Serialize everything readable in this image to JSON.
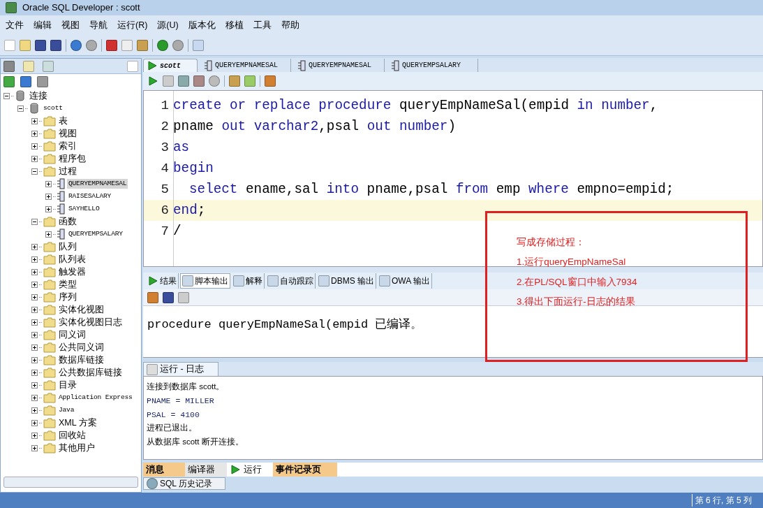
{
  "window": {
    "title": "Oracle SQL Developer : scott"
  },
  "menu": [
    "文件",
    "编辑",
    "视图",
    "导航",
    "运行(R)",
    "源(U)",
    "版本化",
    "移植",
    "工具",
    "帮助"
  ],
  "navigator": {
    "tree": [
      {
        "label": "连接",
        "expanded": true,
        "children": [
          {
            "label": "scott",
            "expanded": true,
            "children": [
              {
                "label": "表",
                "expanded": false,
                "selected": false
              },
              {
                "label": "视图",
                "expanded": false,
                "selected": false
              },
              {
                "label": "索引",
                "expanded": false,
                "selected": false
              },
              {
                "label": "程序包",
                "expanded": false,
                "selected": false
              },
              {
                "label": "过程",
                "expanded": true,
                "selected": false,
                "children": [
                  {
                    "label": "QUERYEMPNAMESAL",
                    "expanded": false,
                    "selected": true
                  },
                  {
                    "label": "RAISESALARY",
                    "expanded": false,
                    "selected": false
                  },
                  {
                    "label": "SAYHELLO",
                    "expanded": false,
                    "selected": false
                  }
                ]
              },
              {
                "label": "函数",
                "expanded": true,
                "selected": false,
                "children": [
                  {
                    "label": "QUERYEMPSALARY",
                    "expanded": false,
                    "selected": false
                  }
                ]
              },
              {
                "label": "队列",
                "expanded": false,
                "selected": false
              },
              {
                "label": "队列表",
                "expanded": false,
                "selected": false
              },
              {
                "label": "触发器",
                "expanded": false,
                "selected": false
              },
              {
                "label": "类型",
                "expanded": false,
                "selected": false
              },
              {
                "label": "序列",
                "expanded": false,
                "selected": false
              },
              {
                "label": "实体化视图",
                "expanded": false,
                "selected": false
              },
              {
                "label": "实体化视图日志",
                "expanded": false,
                "selected": false
              },
              {
                "label": "同义词",
                "expanded": false,
                "selected": false
              },
              {
                "label": "公共同义词",
                "expanded": false,
                "selected": false
              },
              {
                "label": "数据库链接",
                "expanded": false,
                "selected": false
              },
              {
                "label": "公共数据库链接",
                "expanded": false,
                "selected": false
              },
              {
                "label": "目录",
                "expanded": false,
                "selected": false
              },
              {
                "label": "Application Express",
                "expanded": false,
                "selected": false
              },
              {
                "label": "Java",
                "expanded": false,
                "selected": false
              },
              {
                "label": "XML 方案",
                "expanded": false,
                "selected": false
              },
              {
                "label": "回收站",
                "expanded": false,
                "selected": false
              },
              {
                "label": "其他用户",
                "expanded": false,
                "selected": false
              }
            ]
          }
        ]
      }
    ]
  },
  "editor_tabs": [
    {
      "label": "scott",
      "selected": true
    },
    {
      "label": "QUERYEMPNAMESAL",
      "selected": false
    },
    {
      "label": "QUERYEMPNAMESAL",
      "selected": false
    },
    {
      "label": "QUERYEMPSALARY",
      "selected": false
    }
  ],
  "code": [
    {
      "number": "1",
      "current": false,
      "tokens": [
        {
          "kind": "keyword",
          "text": "create or replace procedure "
        },
        {
          "kind": "plain",
          "text": "queryEmpNameSal(empid "
        },
        {
          "kind": "keyword",
          "text": "in number"
        },
        {
          "kind": "plain",
          "text": ","
        }
      ]
    },
    {
      "number": "2",
      "current": false,
      "tokens": [
        {
          "kind": "plain",
          "text": "pname "
        },
        {
          "kind": "keyword",
          "text": "out varchar2"
        },
        {
          "kind": "plain",
          "text": ",psal "
        },
        {
          "kind": "keyword",
          "text": "out number"
        },
        {
          "kind": "plain",
          "text": ")"
        }
      ]
    },
    {
      "number": "3",
      "current": false,
      "tokens": [
        {
          "kind": "keyword",
          "text": "as"
        }
      ]
    },
    {
      "number": "4",
      "current": false,
      "tokens": [
        {
          "kind": "keyword",
          "text": "begin"
        }
      ]
    },
    {
      "number": "5",
      "current": false,
      "indented": true,
      "tokens": [
        {
          "kind": "keyword",
          "text": "select"
        },
        {
          "kind": "plain",
          "text": " ename,sal "
        },
        {
          "kind": "keyword",
          "text": "into"
        },
        {
          "kind": "plain",
          "text": " pname,psal "
        },
        {
          "kind": "keyword",
          "text": "from"
        },
        {
          "kind": "plain",
          "text": " emp "
        },
        {
          "kind": "keyword",
          "text": "where"
        },
        {
          "kind": "plain",
          "text": " empno=empid;"
        }
      ]
    },
    {
      "number": "6",
      "current": true,
      "tokens": [
        {
          "kind": "keyword",
          "text": "end"
        },
        {
          "kind": "plain",
          "text": ";"
        }
      ]
    },
    {
      "number": "7",
      "current": false,
      "tokens": [
        {
          "kind": "plain",
          "text": "/"
        }
      ]
    }
  ],
  "output_tabs": [
    {
      "label": "结果",
      "selected": false
    },
    {
      "label": "脚本输出",
      "selected": true
    },
    {
      "label": "解释",
      "selected": false
    },
    {
      "label": "自动跟踪",
      "selected": false
    },
    {
      "label": "DBMS 输出",
      "selected": false
    },
    {
      "label": "OWA 输出",
      "selected": false
    }
  ],
  "script_output": [
    "procedure queryEmpNameSal(empid 已编译。"
  ],
  "annotation": {
    "lines": [
      "写成存储过程：",
      "1.运行queryEmpNameSal",
      "2.在PL/SQL窗口中输入7934",
      "3.得出下面运行-日志的结果"
    ]
  },
  "log": {
    "title": "运行 - 日志",
    "lines": [
      {
        "text": "连接到数据库 scott。",
        "kind": "message"
      },
      {
        "text": "PNAME = MILLER",
        "kind": "result"
      },
      {
        "text": "PSAL = 4100",
        "kind": "result"
      },
      {
        "text": "进程已退出。",
        "kind": "message"
      },
      {
        "text": "从数据库 scott 断开连接。",
        "kind": "message"
      }
    ]
  },
  "log_tabs": [
    {
      "label": "消息",
      "highlighted": true,
      "selected": false
    },
    {
      "label": "编译器",
      "highlighted": false,
      "selected": false
    },
    {
      "label": "运行",
      "highlighted": false,
      "selected": true
    },
    {
      "label": "事件记录页",
      "highlighted": true,
      "selected": false
    }
  ],
  "history_tab": "SQL 历史记录",
  "status_bar": {
    "position": "第 6 行, 第 5 列"
  }
}
